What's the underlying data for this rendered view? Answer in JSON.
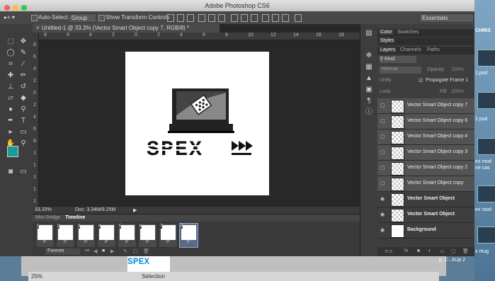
{
  "window_title": "Adobe Photoshop CS6",
  "options_bar": {
    "auto_select_label": "Auto-Select:",
    "auto_select_value": "Group",
    "show_transform_label": "Show Transform Controls",
    "workspace": "Essentials"
  },
  "document": {
    "tab_title": "Untitled-1 @ 33.3% (Vector Smart Object copy 7, RGB/8) *",
    "zoom": "33.33%",
    "doc_info": "Doc: 3.34M/9.25M",
    "ruler_h": [
      "8",
      "6",
      "4",
      "2",
      "0",
      "2",
      "4",
      "6",
      "8",
      "10",
      "12",
      "14",
      "16",
      "18"
    ],
    "ruler_v": [
      "8",
      "6",
      "4",
      "2",
      "0",
      "2",
      "4",
      "6",
      "8",
      "1",
      "1",
      "1",
      "1",
      "1"
    ]
  },
  "timeline": {
    "tabs": [
      "Mini Bridge",
      "Timeline"
    ],
    "frames": [
      {
        "num": "1",
        "dur": "0\""
      },
      {
        "num": "2",
        "dur": "0\""
      },
      {
        "num": "3",
        "dur": "0\""
      },
      {
        "num": "4",
        "dur": "0\""
      },
      {
        "num": "5",
        "dur": "0\""
      },
      {
        "num": "6",
        "dur": "0\""
      },
      {
        "num": "7",
        "dur": "0\""
      },
      {
        "num": "8",
        "dur": "0\""
      }
    ],
    "loop": "Forever"
  },
  "panels": {
    "top_tabs": [
      "Color",
      "Swatches"
    ],
    "styles_tab": "Styles",
    "layer_tabs": [
      "Layers",
      "Channels",
      "Paths"
    ],
    "kind_label": "Kind",
    "blend_mode": "Normal",
    "opacity_label": "Opacity:",
    "opacity_value": "100%",
    "unify_label": "Unify:",
    "propagate_label": "Propagate Frame 1",
    "lock_label": "Lock:",
    "fill_label": "Fill:",
    "fill_value": "100%",
    "layers": [
      {
        "name": "Vector Smart Object copy 7",
        "visible": false,
        "selected": true
      },
      {
        "name": "Vector Smart Object copy 6",
        "visible": false,
        "selected": true
      },
      {
        "name": "Vector Smart Object copy 4",
        "visible": false,
        "selected": true
      },
      {
        "name": "Vector Smart Object copy 3",
        "visible": false,
        "selected": true
      },
      {
        "name": "Vector Smart Object copy 2",
        "visible": false,
        "selected": true
      },
      {
        "name": "Vector Smart Object copy",
        "visible": false,
        "selected": true
      },
      {
        "name": "Vector Smart Object",
        "visible": true,
        "selected": false,
        "bold": true
      },
      {
        "name": "Vector Smart Object",
        "visible": true,
        "selected": false,
        "bold": true
      },
      {
        "name": "Background",
        "visible": true,
        "selected": false,
        "bold": true
      }
    ]
  },
  "canvas": {
    "art_text": "SPEX"
  },
  "desktop": {
    "top_label": "CHRIS",
    "items": [
      "1.psd",
      "2.psd",
      "ex mod",
      "ne cas",
      "ex mod",
      "x mug"
    ],
    "bg_label": "p_C...kUp 2",
    "bg_zoom": "25%",
    "bg_selection": "Selection"
  }
}
